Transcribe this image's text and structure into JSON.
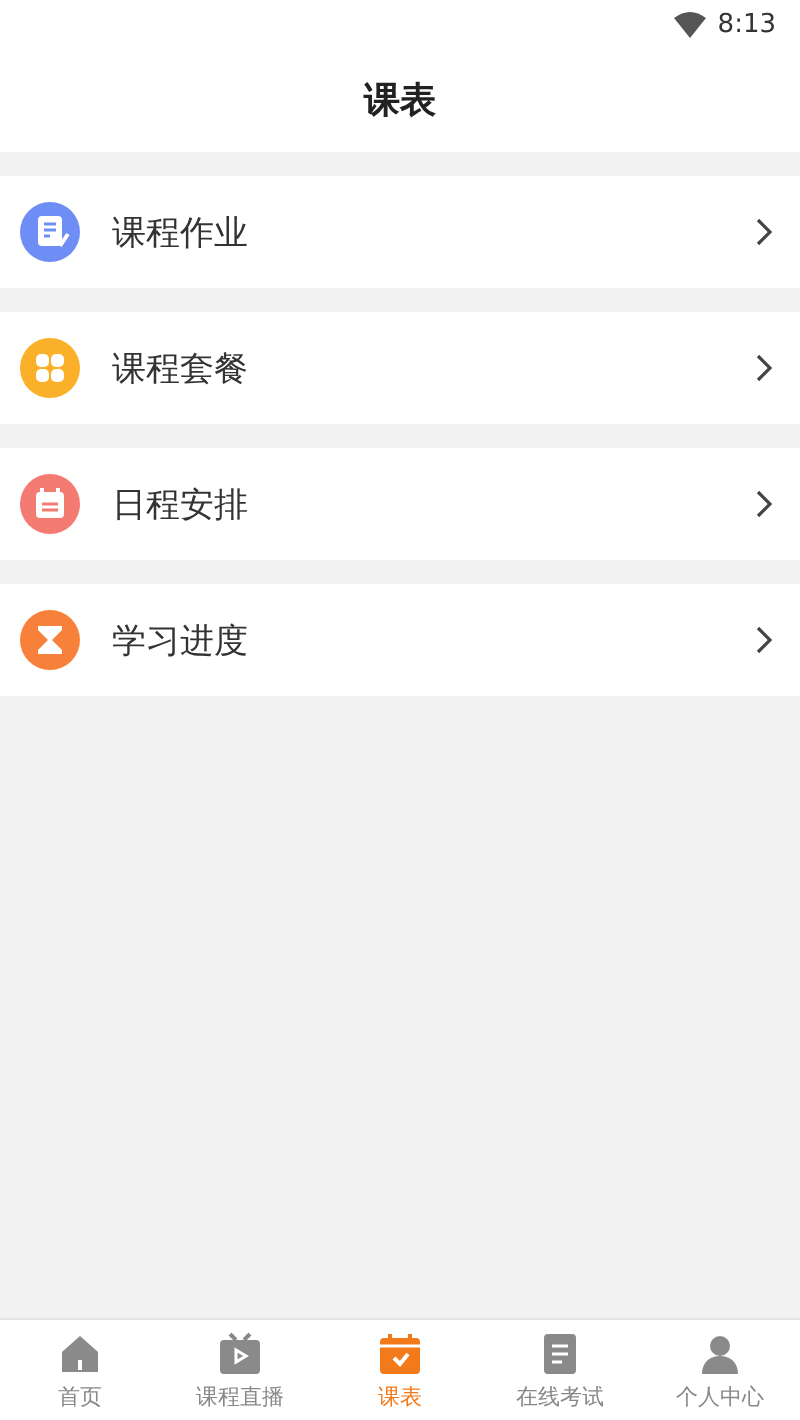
{
  "status_bar": {
    "time": "8:13"
  },
  "header": {
    "title": "课表"
  },
  "menu": [
    {
      "label": "课程作业",
      "kind": "notes",
      "color": "#6f8ef5"
    },
    {
      "label": "课程套餐",
      "kind": "grid",
      "color": "#fbb02a"
    },
    {
      "label": "日程安排",
      "kind": "calendar",
      "color": "#f47b72"
    },
    {
      "label": "学习进度",
      "kind": "hourglass",
      "color": "#f7813a"
    }
  ],
  "tabs": [
    {
      "label": "首页",
      "kind": "home",
      "selected": false
    },
    {
      "label": "课程直播",
      "kind": "live",
      "selected": false
    },
    {
      "label": "课表",
      "kind": "schedule",
      "selected": true
    },
    {
      "label": "在线考试",
      "kind": "exam",
      "selected": false
    },
    {
      "label": "个人中心",
      "kind": "user",
      "selected": false
    }
  ]
}
